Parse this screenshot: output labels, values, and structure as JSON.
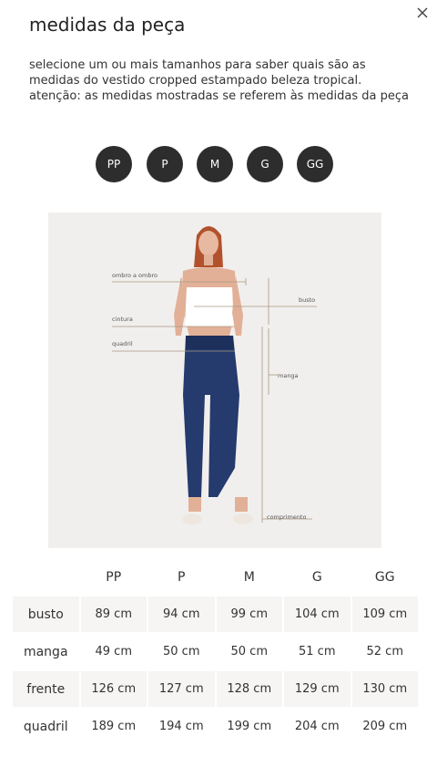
{
  "modal": {
    "title": "medidas da peça",
    "description": "selecione um ou mais tamanhos para saber quais são as medidas do vestido cropped estampado beleza tropical. atenção: as medidas mostradas se referem às medidas da peça"
  },
  "sizes": [
    "PP",
    "P",
    "M",
    "G",
    "GG"
  ],
  "figure": {
    "labels": {
      "ombro": "ombro a ombro",
      "busto": "busto",
      "cintura": "cintura",
      "quadril": "quadril",
      "manga": "manga",
      "comprimento": "comprimento"
    }
  },
  "table": {
    "columns": [
      "PP",
      "P",
      "M",
      "G",
      "GG"
    ],
    "rows": [
      {
        "label": "busto",
        "values": [
          "89 cm",
          "94 cm",
          "99 cm",
          "104 cm",
          "109 cm"
        ]
      },
      {
        "label": "manga",
        "values": [
          "49 cm",
          "50 cm",
          "50 cm",
          "51 cm",
          "52 cm"
        ]
      },
      {
        "label": "frente",
        "values": [
          "126 cm",
          "127 cm",
          "128 cm",
          "129 cm",
          "130 cm"
        ]
      },
      {
        "label": "quadril",
        "values": [
          "189 cm",
          "194 cm",
          "199 cm",
          "204 cm",
          "209 cm"
        ]
      }
    ]
  }
}
